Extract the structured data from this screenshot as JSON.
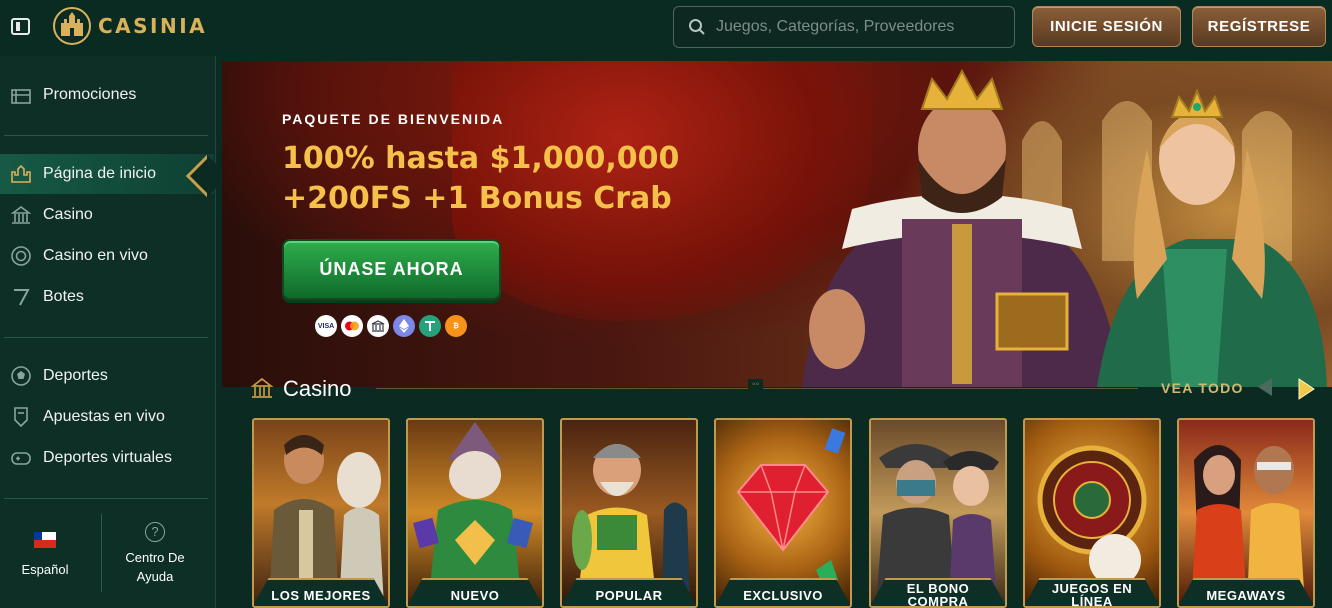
{
  "brand": {
    "name": "CASINIA"
  },
  "header": {
    "search_placeholder": "Juegos, Categorías, Proveedores",
    "login_label": "INICIE SESIÓN",
    "register_label": "REGÍSTRESE"
  },
  "sidebar": {
    "items": [
      {
        "label": "Promociones",
        "icon": "gift-icon"
      },
      {
        "label": "Página de inicio",
        "icon": "castle-icon",
        "active": true
      },
      {
        "label": "Casino",
        "icon": "building-icon"
      },
      {
        "label": "Casino en vivo",
        "icon": "chip-icon"
      },
      {
        "label": "Botes",
        "icon": "seven-icon"
      },
      {
        "label": "Deportes",
        "icon": "soccer-ball-icon"
      },
      {
        "label": "Apuestas en vivo",
        "icon": "live-bet-icon"
      },
      {
        "label": "Deportes virtuales",
        "icon": "gamepad-icon"
      }
    ],
    "language": "Español",
    "help": "Centro De Ayuda"
  },
  "hero": {
    "tag": "PAQUETE DE BIENVENIDA",
    "title_line1": "100% hasta $1,000,000",
    "title_line2": "+200FS +1 Bonus Crab",
    "cta": "ÚNASE AHORA",
    "payments": [
      "VISA",
      "mastercard",
      "bank",
      "ethereum",
      "tether",
      "bitcoin"
    ]
  },
  "casino_section": {
    "title": "Casino",
    "see_all": "VEA TODO",
    "tiles": [
      {
        "label": "LOS MEJORES"
      },
      {
        "label": "NUEVO"
      },
      {
        "label": "POPULAR"
      },
      {
        "label": "EXCLUSIVO"
      },
      {
        "label": "EL BONO COMPRA"
      },
      {
        "label": "JUEGOS EN LÍNEA"
      },
      {
        "label": "MEGAWAYS"
      }
    ]
  },
  "colors": {
    "accent_gold": "#c19a52",
    "title_gold": "#f6c14a",
    "bg": "#0b2a22",
    "cta_green": "#1f8c3b"
  }
}
